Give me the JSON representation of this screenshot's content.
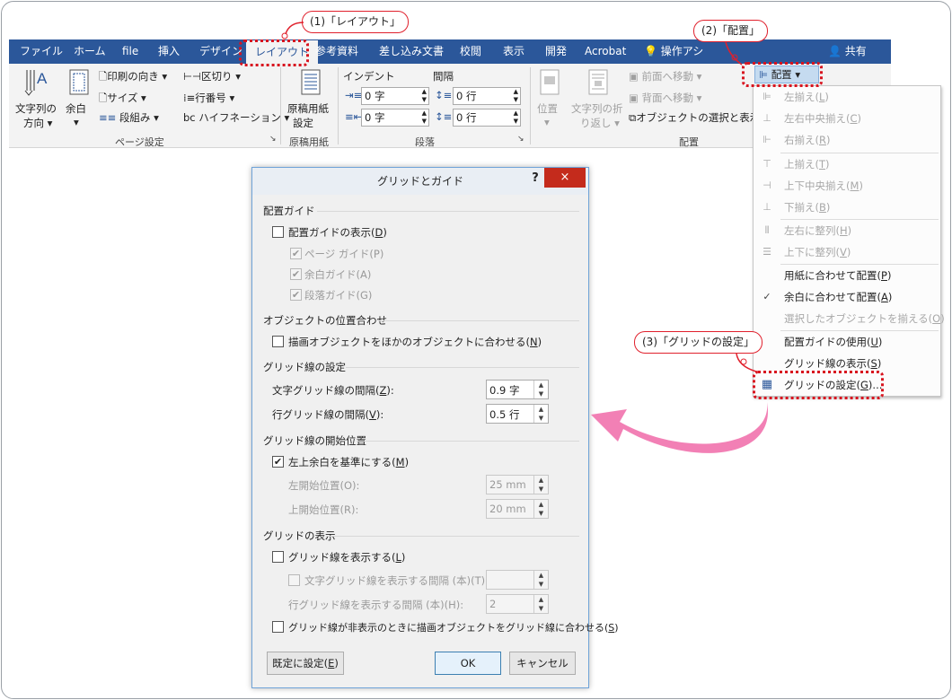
{
  "tabs": [
    {
      "label": "ファイル"
    },
    {
      "label": "ホーム"
    },
    {
      "label": "file"
    },
    {
      "label": "挿入"
    },
    {
      "label": "デザイン"
    },
    {
      "label": "レイアウト"
    },
    {
      "label": "参考資料"
    },
    {
      "label": "差し込み文書"
    },
    {
      "label": "校閲"
    },
    {
      "label": "表示"
    },
    {
      "label": "開発"
    },
    {
      "label": "Acrobat"
    },
    {
      "label": "操作アシ"
    },
    {
      "label": "共有"
    }
  ],
  "ribbon": {
    "text_direction": "文字列の\n方向",
    "text_direction_l1": "文字列の",
    "text_direction_l2": "方向",
    "margins": "余白",
    "orientation": "印刷の向き",
    "size": "サイズ",
    "columns": "段組み",
    "breaks": "区切り",
    "line_numbers": "行番号",
    "hyphenation": "ハイフネーション",
    "page_setup_group": "ページ設定",
    "manuscript_l1": "原稿用紙",
    "manuscript_l2": "設定",
    "manuscript_group": "原稿用紙",
    "indent_label": "インデント",
    "spacing_label": "間隔",
    "indent_left": "0 字",
    "indent_right": "0 字",
    "space_before": "0 行",
    "space_after": "0 行",
    "paragraph_group": "段落",
    "position": "位置",
    "wrap_l1": "文字列の折",
    "wrap_l2": "り返し",
    "bring_forward": "前面へ移動",
    "send_backward": "背面へ移動",
    "selection_pane": "オブジェクトの選択と表示",
    "arrange_group": "配置",
    "align_button": "配置"
  },
  "menu": {
    "items": [
      {
        "label": "左揃え(L)",
        "accel": "L",
        "base": "左揃え",
        "enabled": false
      },
      {
        "label": "左右中央揃え(C)",
        "base": "左右中央揃え",
        "accel": "C",
        "enabled": false
      },
      {
        "label": "右揃え(R)",
        "base": "右揃え",
        "accel": "R",
        "enabled": false
      },
      {
        "label": "上揃え(T)",
        "base": "上揃え",
        "accel": "T",
        "enabled": false
      },
      {
        "label": "上下中央揃え(M)",
        "base": "上下中央揃え",
        "accel": "M",
        "enabled": false
      },
      {
        "label": "下揃え(B)",
        "base": "下揃え",
        "accel": "B",
        "enabled": false
      },
      {
        "label": "左右に整列(H)",
        "base": "左右に整列",
        "accel": "H",
        "enabled": false
      },
      {
        "label": "上下に整列(V)",
        "base": "上下に整列",
        "accel": "V",
        "enabled": false
      },
      {
        "label": "用紙に合わせて配置(P)",
        "base": "用紙に合わせて配置",
        "accel": "P",
        "enabled": true
      },
      {
        "label": "余白に合わせて配置(A)",
        "base": "余白に合わせて配置",
        "accel": "A",
        "enabled": true,
        "checked": true
      },
      {
        "label": "選択したオブジェクトを揃える(O)",
        "base": "選択したオブジェクトを揃える",
        "accel": "O",
        "enabled": false
      },
      {
        "label": "配置ガイドの使用(U)",
        "base": "配置ガイドの使用",
        "accel": "U",
        "enabled": true
      },
      {
        "label": "グリッド線の表示(S)",
        "base": "グリッド線の表示",
        "accel": "S",
        "enabled": true
      },
      {
        "label": "グリッドの設定(G)...",
        "base": "グリッドの設定",
        "accel": "G",
        "suffix": "...",
        "enabled": true
      }
    ]
  },
  "dialog": {
    "title": "グリッドとガイド",
    "help": "?",
    "close": "×",
    "sec_guides": "配置ガイド",
    "show_guides": {
      "base": "配置ガイドの表示",
      "accel": "D",
      "checked": false
    },
    "page_guides": "ページ ガイド(P)",
    "margin_guides": "余白ガイド(A)",
    "paragraph_guides": "段落ガイド(G)",
    "sec_snap": "オブジェクトの位置合わせ",
    "snap_objects": {
      "base": "描画オブジェクトをほかのオブジェクトに合わせる",
      "accel": "N",
      "checked": false
    },
    "sec_grid": "グリッド線の設定",
    "char_grid": {
      "base": "文字グリッド線の間隔",
      "accel": "Z",
      "value": "0.9 字"
    },
    "line_grid": {
      "base": "行グリッド線の間隔",
      "accel": "V",
      "value": "0.5 行"
    },
    "sec_origin": "グリッド線の開始位置",
    "use_margins": {
      "base": "左上余白を基準にする",
      "accel": "M",
      "checked": true
    },
    "h_origin": {
      "label": "左開始位置(O):",
      "value": "25 mm"
    },
    "v_origin": {
      "label": "上開始位置(R):",
      "value": "20 mm"
    },
    "sec_display": "グリッドの表示",
    "show_grid": {
      "base": "グリッド線を表示する",
      "accel": "L",
      "checked": false
    },
    "char_grid_every": {
      "label": "文字グリッド線を表示する間隔 (本)(T):",
      "value": ""
    },
    "line_grid_every": {
      "label": "行グリッド線を表示する間隔 (本)(H):",
      "value": "2"
    },
    "snap_hidden": {
      "base": "グリッド線が非表示のときに描画オブジェクトをグリッド線に合わせる",
      "accel": "S",
      "checked": false
    },
    "btn_default": {
      "base": "既定に設定",
      "accel": "E"
    },
    "btn_ok": "OK",
    "btn_cancel": "キャンセル"
  },
  "callouts": {
    "c1": "(1)「レイアウト」",
    "c2": "(2)「配置」",
    "c3": "(3)「グリッドの設定」"
  },
  "colors": {
    "tabbar": "#2b579a",
    "accent_red": "#d8141f",
    "arrow_pink": "#f06aa8"
  }
}
